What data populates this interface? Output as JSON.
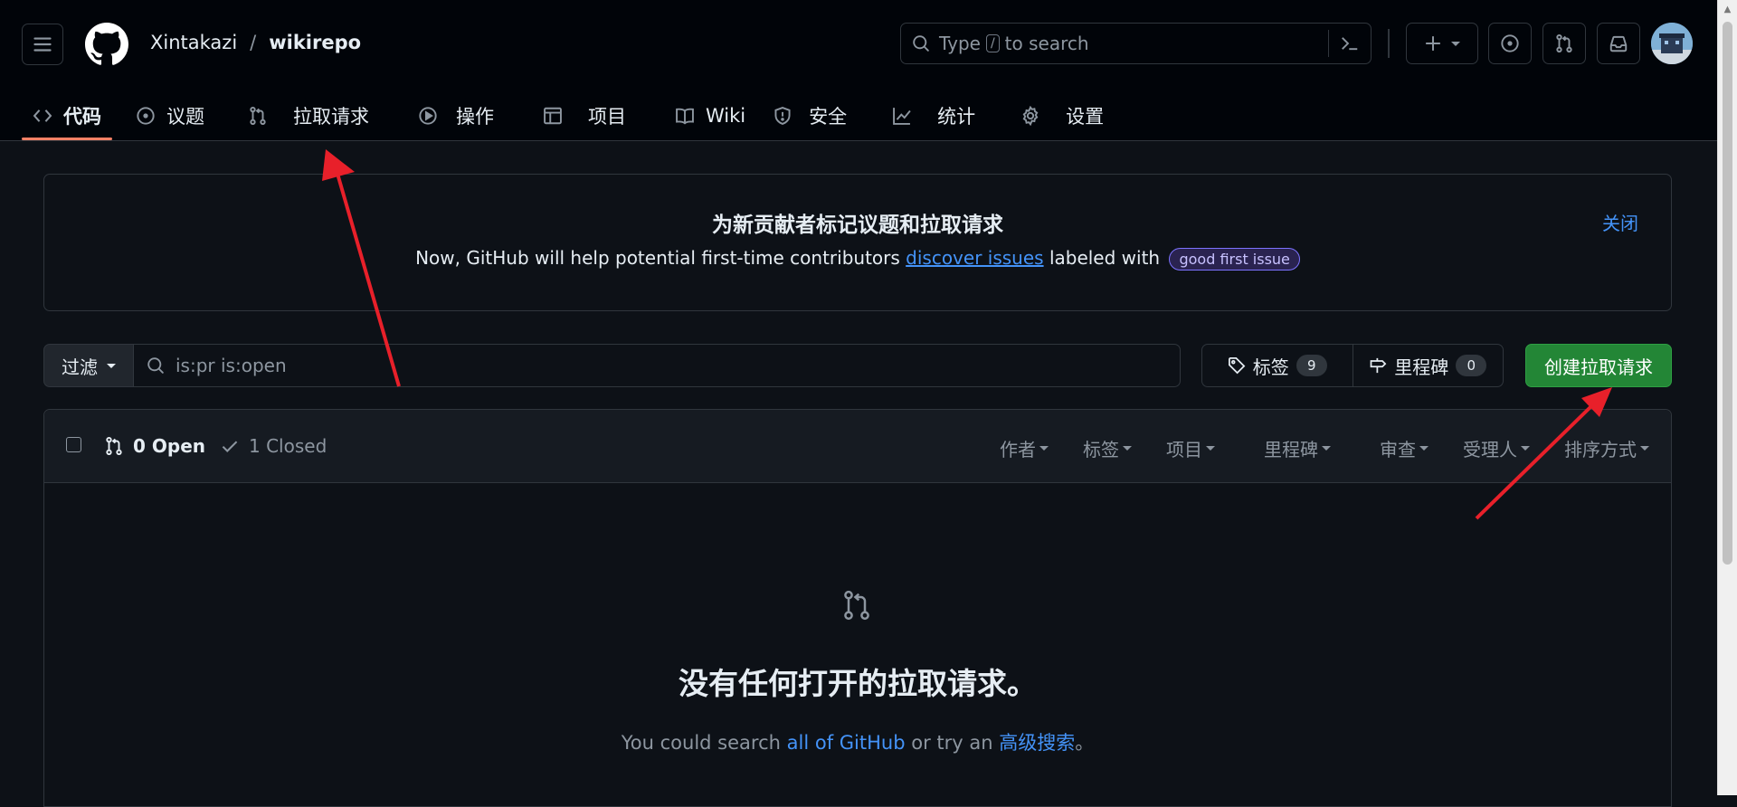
{
  "header": {
    "owner": "Xintakazi",
    "path_separator": "/",
    "repo": "wikirepo",
    "search_prefix": "Type",
    "search_slash": "/",
    "search_suffix": "to search",
    "avatar_icon": "avatar-image"
  },
  "tabs": [
    {
      "label": "代码",
      "icon": "code-icon",
      "active": true
    },
    {
      "label": "议题",
      "icon": "issue-icon"
    },
    {
      "label": "拉取请求",
      "icon": "pull-request-icon"
    },
    {
      "label": "操作",
      "icon": "play-icon"
    },
    {
      "label": "项目",
      "icon": "table-icon"
    },
    {
      "label": "Wiki",
      "icon": "book-icon"
    },
    {
      "label": "安全",
      "icon": "shield-icon"
    },
    {
      "label": "统计",
      "icon": "graph-icon"
    },
    {
      "label": "设置",
      "icon": "gear-icon"
    }
  ],
  "banner": {
    "title": "为新贡献者标记议题和拉取请求",
    "text_before": "Now, GitHub will help potential first-time contributors",
    "link": "discover issues",
    "text_after": "labeled with",
    "label": "good first issue",
    "close": "关闭"
  },
  "filters": {
    "filter_label": "过滤",
    "query": "is:pr is:open",
    "labels_label": "标签",
    "labels_count": "9",
    "milestones_label": "里程碑",
    "milestones_count": "0",
    "new_pr": "创建拉取请求"
  },
  "list": {
    "open": "0 Open",
    "closed": "1 Closed",
    "sort": [
      "作者",
      "标签",
      "项目",
      "里程碑",
      "审查",
      "受理人",
      "排序方式"
    ],
    "empty_title": "没有任何打开的拉取请求。",
    "empty_text_before": "You could search",
    "empty_link1": "all of GitHub",
    "empty_text_mid": "or try an",
    "empty_link2": "高级搜索",
    "empty_text_end": "。"
  },
  "colors": {
    "background": "#0d1117",
    "header_bg": "#010409",
    "accent_link": "#4493f8",
    "primary_button": "#238636",
    "active_tab_underline": "#f78166",
    "annotation_arrow": "#e8202a"
  }
}
